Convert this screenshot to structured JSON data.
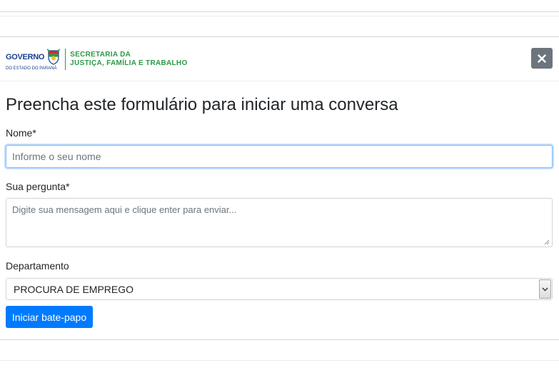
{
  "header": {
    "logo_governo": "GOVERNO",
    "logo_governo_sub": "DO ESTADO DO PARANÁ",
    "logo_secretaria_line1": "SECRETARIA DA",
    "logo_secretaria_line2": "JUSTIÇA, FAMÍLIA E TRABALHO",
    "close_icon": "close-icon"
  },
  "form": {
    "title": "Preencha este formulário para iniciar uma conversa",
    "name_label": "Nome*",
    "name_placeholder": "Informe o seu nome",
    "name_value": "",
    "question_label": "Sua pergunta*",
    "question_placeholder": "Digite sua mensagem aqui e clique enter para enviar...",
    "question_value": "",
    "department_label": "Departamento",
    "department_selected": "PROCURA DE EMPREGO",
    "submit_label": "Iniciar bate-papo"
  },
  "colors": {
    "primary": "#007bff",
    "secondary": "#6c757d",
    "brand_green": "#2a9a45",
    "brand_blue": "#1a3f8e"
  }
}
